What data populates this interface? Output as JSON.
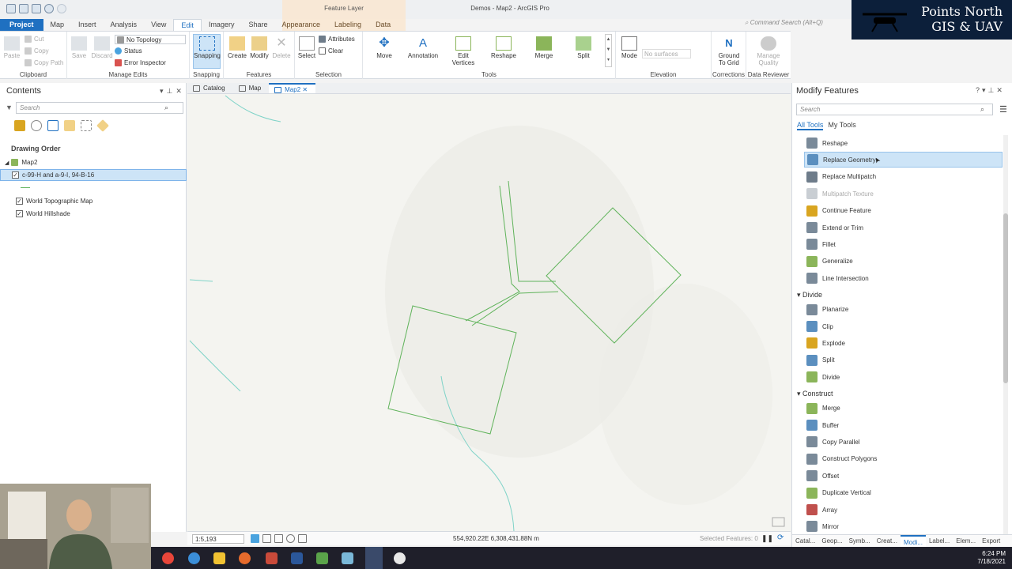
{
  "window": {
    "app_title": "Demos - Map2 - ArcGIS Pro",
    "context_title": "Feature Layer",
    "command_search_placeholder": "Command Search (Alt+Q)"
  },
  "logo": {
    "line1": "Points North",
    "line2": "GIS & UAV"
  },
  "ribbon": {
    "tabs": [
      {
        "label": "Project"
      },
      {
        "label": "Map"
      },
      {
        "label": "Insert"
      },
      {
        "label": "Analysis"
      },
      {
        "label": "View"
      },
      {
        "label": "Edit"
      },
      {
        "label": "Imagery"
      },
      {
        "label": "Share"
      },
      {
        "label": "Appearance"
      },
      {
        "label": "Labeling"
      },
      {
        "label": "Data"
      }
    ],
    "clipboard": {
      "paste": "Paste",
      "cut": "Cut",
      "copy": "Copy",
      "copy_path": "Copy Path",
      "label": "Clipboard"
    },
    "manage_edits": {
      "save": "Save",
      "discard": "Discard",
      "topology": "No Topology",
      "status": "Status",
      "error_inspector": "Error Inspector",
      "label": "Manage Edits"
    },
    "snapping": {
      "button": "Snapping",
      "label": "Snapping"
    },
    "features": {
      "create": "Create",
      "modify": "Modify",
      "delete": "Delete",
      "label": "Features"
    },
    "selection": {
      "select": "Select",
      "attributes": "Attributes",
      "clear": "Clear",
      "label": "Selection"
    },
    "tools": {
      "move": "Move",
      "annotation": "Annotation",
      "edit_vertices_1": "Edit",
      "edit_vertices_2": "Vertices",
      "reshape": "Reshape",
      "merge": "Merge",
      "split": "Split",
      "label": "Tools"
    },
    "elevation": {
      "mode": "Mode",
      "surfaces": "No surfaces",
      "label": "Elevation"
    },
    "corrections": {
      "ground_1": "Ground",
      "ground_2": "To Grid",
      "label": "Corrections"
    },
    "data_reviewer": {
      "quality_1": "Manage",
      "quality_2": "Quality",
      "label": "Data Reviewer"
    }
  },
  "contents": {
    "title": "Contents",
    "search_placeholder": "Search",
    "section": "Drawing Order",
    "map_name": "Map2",
    "layers": [
      {
        "name": "c-99-H and a-9-I, 94-B-16",
        "checked": "✓"
      },
      {
        "name": "World Topographic Map",
        "checked": "✓"
      },
      {
        "name": "World Hillshade",
        "checked": "✓"
      }
    ]
  },
  "views": {
    "tabs": [
      {
        "label": "Catalog"
      },
      {
        "label": "Map"
      },
      {
        "label": "Map2"
      }
    ]
  },
  "status": {
    "scale": "1:5,193",
    "coordinates": "554,920.22E 6,308,431.88N m",
    "selected": "Selected Features: 0"
  },
  "modify": {
    "title": "Modify Features",
    "search_placeholder": "Search",
    "tabs": {
      "all": "All Tools",
      "mine": "My Tools"
    },
    "reshape_tools": [
      {
        "label": "Reshape",
        "color": "#7a8a99"
      },
      {
        "label": "Replace Geometry",
        "color": "#5b8fbf"
      },
      {
        "label": "Replace Multipatch",
        "color": "#6e7c8a"
      },
      {
        "label": "Multipatch Texture",
        "color": "#c9ced3"
      },
      {
        "label": "Continue Feature",
        "color": "#d9a520"
      },
      {
        "label": "Extend or Trim",
        "color": "#7a8a99"
      },
      {
        "label": "Fillet",
        "color": "#7a8a99"
      },
      {
        "label": "Generalize",
        "color": "#8bb55a"
      },
      {
        "label": "Line Intersection",
        "color": "#7a8a99"
      }
    ],
    "divide_header": "Divide",
    "divide_tools": [
      {
        "label": "Planarize",
        "color": "#7a8a99"
      },
      {
        "label": "Clip",
        "color": "#5b8fbf"
      },
      {
        "label": "Explode",
        "color": "#d9a520"
      },
      {
        "label": "Split",
        "color": "#5b8fbf"
      },
      {
        "label": "Divide",
        "color": "#8bb55a"
      }
    ],
    "construct_header": "Construct",
    "construct_tools": [
      {
        "label": "Merge",
        "color": "#8bb55a"
      },
      {
        "label": "Buffer",
        "color": "#5b8fbf"
      },
      {
        "label": "Copy Parallel",
        "color": "#7a8a99"
      },
      {
        "label": "Construct Polygons",
        "color": "#7a8a99"
      },
      {
        "label": "Offset",
        "color": "#7a8a99"
      },
      {
        "label": "Duplicate Vertical",
        "color": "#8bb55a"
      },
      {
        "label": "Array",
        "color": "#c0504d"
      },
      {
        "label": "Mirror",
        "color": "#7a8a99"
      }
    ],
    "bottom_tabs": [
      "Catal...",
      "Geop...",
      "Symb...",
      "Creat...",
      "Modi...",
      "Label...",
      "Elem...",
      "Export"
    ]
  },
  "taskbar": {
    "time": "6:24 PM",
    "date": "7/18/2021"
  },
  "colors": {
    "accent": "#1f70c1",
    "feature_line": "#5fb35a",
    "stream": "#7fd3c8"
  }
}
